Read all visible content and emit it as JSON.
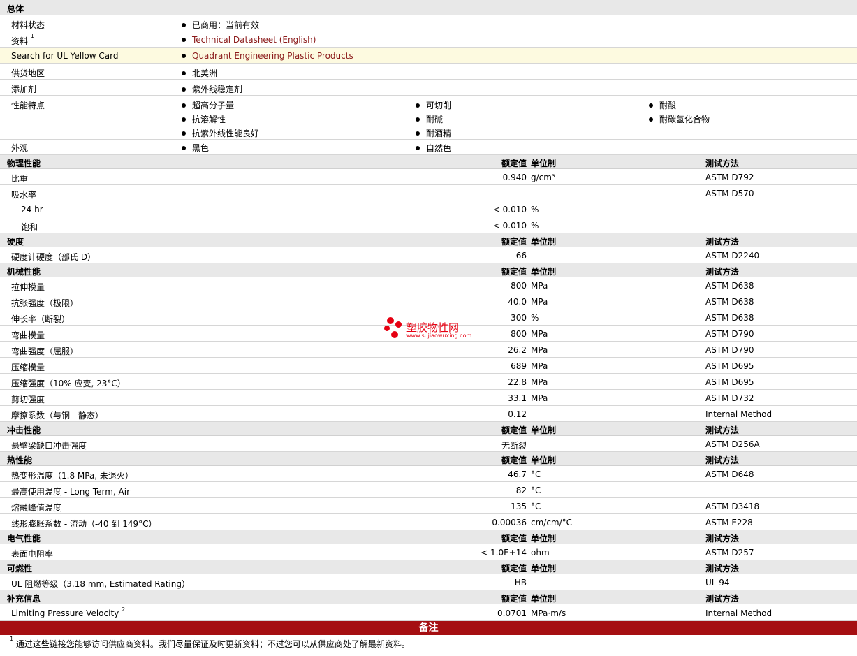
{
  "general": {
    "title": "总体",
    "rows": [
      {
        "label": "材料状态",
        "value": "已商用：当前有效"
      },
      {
        "label": "资料",
        "sup": "1",
        "value": "Technical Datasheet (English)"
      },
      {
        "label": "Search for UL Yellow Card",
        "value": "Quadrant Engineering Plastic Products"
      },
      {
        "label": "供货地区",
        "value": "北美洲"
      },
      {
        "label": "添加剂",
        "value": "紫外线稳定剂"
      }
    ],
    "features_label": "性能特点",
    "features": [
      "超高分子量",
      "可切削",
      "耐酸",
      "抗溶解性",
      "耐碱",
      "耐碳氢化合物",
      "抗紫外线性能良好",
      "耐酒精"
    ],
    "appearance_label": "外观",
    "appearance": [
      "黑色",
      "自然色"
    ]
  },
  "headers": {
    "nominal": "额定值",
    "unit": "单位制",
    "method": "测试方法"
  },
  "physical": {
    "title": "物理性能",
    "rows": [
      {
        "label": "比重",
        "value": "0.940",
        "unit": "g/cm³",
        "method": "ASTM D792"
      },
      {
        "label": "吸水率",
        "value": "",
        "unit": "",
        "method": "ASTM D570"
      },
      {
        "label": "24 hr",
        "value": "< 0.010",
        "unit": "%",
        "method": ""
      },
      {
        "label": "饱和",
        "value": "< 0.010",
        "unit": "%",
        "method": ""
      }
    ]
  },
  "hardness": {
    "title": "硬度",
    "rows": [
      {
        "label": "硬度计硬度（部氏 D）",
        "value": "66",
        "unit": "",
        "method": "ASTM D2240"
      }
    ]
  },
  "mechanical": {
    "title": "机械性能",
    "rows": [
      {
        "label": "拉伸模量",
        "value": "800",
        "unit": "MPa",
        "method": "ASTM D638"
      },
      {
        "label": "抗张强度（极限）",
        "value": "40.0",
        "unit": "MPa",
        "method": "ASTM D638"
      },
      {
        "label": "伸长率（断裂）",
        "value": "300",
        "unit": "%",
        "method": "ASTM D638"
      },
      {
        "label": "弯曲模量",
        "value": "800",
        "unit": "MPa",
        "method": "ASTM D790"
      },
      {
        "label": "弯曲强度（屈服）",
        "value": "26.2",
        "unit": "MPa",
        "method": "ASTM D790"
      },
      {
        "label": "压缩模量",
        "value": "689",
        "unit": "MPa",
        "method": "ASTM D695"
      },
      {
        "label": "压缩强度（10% 应变, 23°C）",
        "value": "22.8",
        "unit": "MPa",
        "method": "ASTM D695"
      },
      {
        "label": "剪切强度",
        "value": "33.1",
        "unit": "MPa",
        "method": "ASTM D732"
      },
      {
        "label": "摩擦系数（与钢 - 静态）",
        "value": "0.12",
        "unit": "",
        "method": "Internal Method"
      }
    ]
  },
  "impact": {
    "title": "冲击性能",
    "rows": [
      {
        "label": "悬壁梁缺口冲击强度",
        "value": "无断裂",
        "unit": "",
        "method": "ASTM D256A"
      }
    ]
  },
  "thermal": {
    "title": "热性能",
    "rows": [
      {
        "label": "热变形温度（1.8 MPa, 未退火）",
        "value": "46.7",
        "unit": "°C",
        "method": "ASTM D648"
      },
      {
        "label": "最高使用温度 - Long Term, Air",
        "value": "82",
        "unit": "°C",
        "method": ""
      },
      {
        "label": "熔融峰值温度",
        "value": "135",
        "unit": "°C",
        "method": "ASTM D3418"
      },
      {
        "label": "线形膨胀系数 - 流动（-40 到 149°C）",
        "value": "0.00036",
        "unit": "cm/cm/°C",
        "method": "ASTM E228"
      }
    ]
  },
  "electrical": {
    "title": "电气性能",
    "rows": [
      {
        "label": "表面电阻率",
        "value": "< 1.0E+14",
        "unit": "ohm",
        "method": "ASTM D257"
      }
    ]
  },
  "flammability": {
    "title": "可燃性",
    "rows": [
      {
        "label": "UL 阻燃等级（3.18 mm, Estimated Rating）",
        "value": "HB",
        "unit": "",
        "method": "UL 94"
      }
    ]
  },
  "supplemental": {
    "title": "补充信息",
    "rows": [
      {
        "label": "Limiting Pressure Velocity",
        "sup": "2",
        "value": "0.0701",
        "unit": "MPa·m/s",
        "method": "Internal Method"
      }
    ]
  },
  "notes": {
    "title": "备注",
    "items": [
      {
        "num": "1",
        "text": "通过这些链接您能够访问供应商资料。我们尽量保证及时更新资料；不过您可以从供应商处了解最新资料。"
      }
    ]
  },
  "watermark": {
    "name": "塑胶物性网",
    "url": "www.sujiaowuxing.com"
  },
  "colors": {
    "link": "#8b1a1a",
    "notes_bar": "#a50f12",
    "section_bg": "#e8e8e8",
    "highlight_row": "#fdfae0",
    "watermark": "#e60012"
  }
}
